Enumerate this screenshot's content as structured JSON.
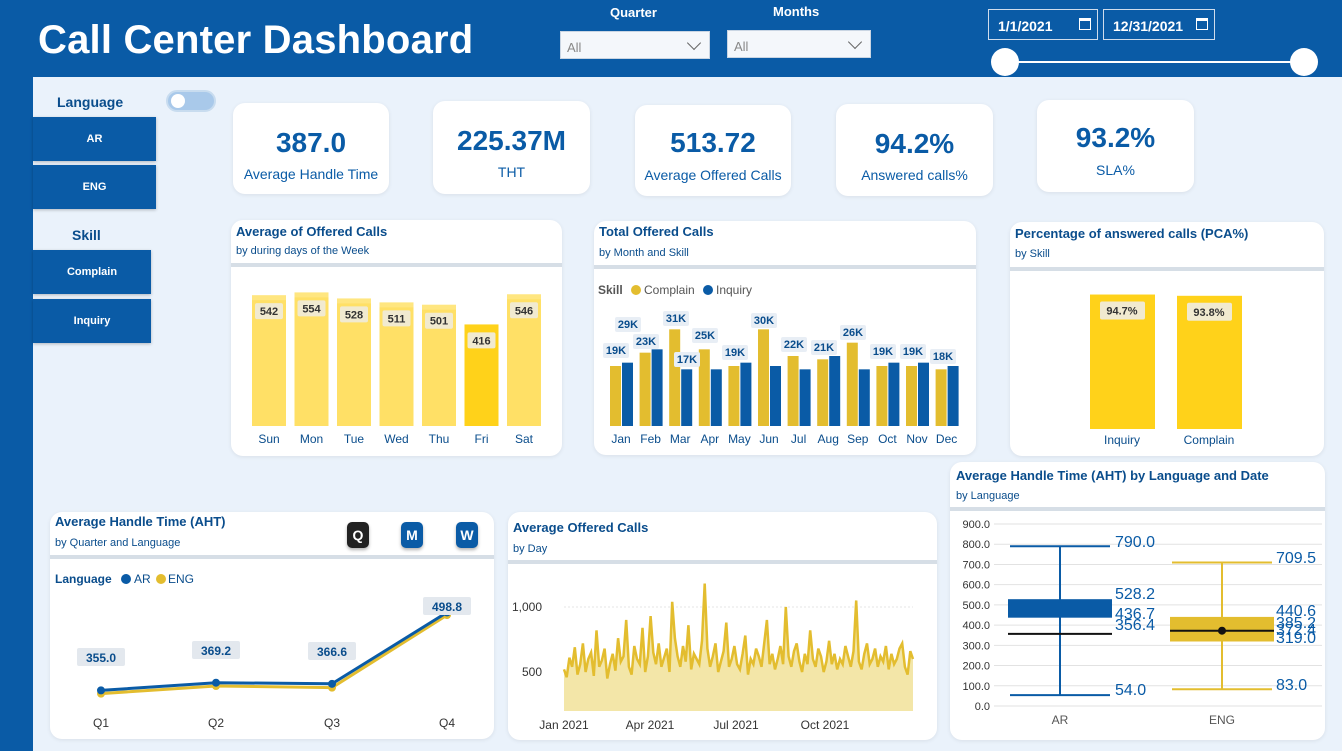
{
  "header": {
    "title": "Call Center Dashboard",
    "quarter_label": "Quarter",
    "quarter_value": "All",
    "months_label": "Months",
    "months_value": "All",
    "start_date": "1/1/2021",
    "end_date": "12/31/2021"
  },
  "sidebar": {
    "language_title": "Language",
    "language_items": [
      "AR",
      "ENG"
    ],
    "skill_title": "Skill",
    "skill_items": [
      "Complain",
      "Inquiry"
    ]
  },
  "kpis": [
    {
      "value": "387.0",
      "label": "Average Handle Time"
    },
    {
      "value": "225.37M",
      "label": "THT"
    },
    {
      "value": "513.72",
      "label": "Average Offered Calls"
    },
    {
      "value": "94.2%",
      "label": "Answered calls%"
    },
    {
      "value": "93.2%",
      "label": "SLA%"
    }
  ],
  "colors": {
    "blue": "#0a5ba6",
    "yellow": "#e3bd2f",
    "light_yellow": "#ffe066",
    "bright_yellow": "#ffd21a"
  },
  "charts": {
    "weekday": {
      "title": "Average of Offered Calls",
      "subtitle": "by during days of the Week"
    },
    "monthly": {
      "title": "Total Offered Calls",
      "subtitle": "by Month and Skill",
      "legend_title": "Skill"
    },
    "pca": {
      "title": "Percentage of answered calls (PCA%)",
      "subtitle": "by Skill"
    },
    "aht_line": {
      "title": "Average Handle Time (AHT)",
      "subtitle": "by Quarter and Language",
      "legend_title": "Language",
      "buttons": [
        "Q",
        "M",
        "W"
      ]
    },
    "daily": {
      "title": "Average Offered Calls",
      "subtitle": "by Day"
    },
    "boxplot": {
      "title": "Average Handle Time (AHT) by Language and Date",
      "subtitle": "by Language"
    }
  },
  "chart_data": [
    {
      "id": "weekday",
      "type": "bar",
      "categories": [
        "Sun",
        "Mon",
        "Tue",
        "Wed",
        "Thu",
        "Fri",
        "Sat"
      ],
      "values": [
        542,
        554,
        528,
        511,
        501,
        416,
        546
      ],
      "highlight": "Fri"
    },
    {
      "id": "monthly",
      "type": "bar",
      "categories": [
        "Jan",
        "Feb",
        "Mar",
        "Apr",
        "May",
        "Jun",
        "Jul",
        "Aug",
        "Sep",
        "Oct",
        "Nov",
        "Dec"
      ],
      "series": [
        {
          "name": "Complain",
          "values": [
            18,
            22,
            29,
            23,
            18,
            29,
            21,
            20,
            25,
            18,
            18,
            17
          ]
        },
        {
          "name": "Inquiry",
          "values": [
            19,
            23,
            17,
            17,
            19,
            18,
            17,
            21,
            17,
            19,
            19,
            18
          ]
        }
      ],
      "data_labels": [
        "19K",
        "29K",
        "23K",
        "31K",
        "17K",
        "25K",
        "19K",
        "30K",
        "22K",
        "21K",
        "26K",
        "19K",
        "19K",
        "18K"
      ],
      "ylim": [
        0,
        33
      ]
    },
    {
      "id": "pca",
      "type": "bar",
      "categories": [
        "Inquiry",
        "Complain"
      ],
      "values": [
        94.7,
        93.8
      ],
      "data_labels": [
        "94.7%",
        "93.8%"
      ]
    },
    {
      "id": "aht_line",
      "type": "line",
      "categories": [
        "Q1",
        "Q2",
        "Q3",
        "Q4"
      ],
      "series": [
        {
          "name": "AR",
          "values": [
            358,
            372,
            370,
            501
          ]
        },
        {
          "name": "ENG",
          "values": [
            352,
            366,
            363,
            496
          ]
        }
      ],
      "data_labels": [
        "355.0",
        "369.2",
        "366.6",
        "498.8"
      ]
    },
    {
      "id": "daily",
      "type": "area",
      "x_ticks": [
        "Jan 2021",
        "Apr 2021",
        "Jul 2021",
        "Oct 2021"
      ],
      "y_ticks": [
        "500",
        "1,000"
      ],
      "ylim": [
        200,
        1200
      ],
      "values": [
        520,
        460,
        610,
        540,
        690,
        480,
        560,
        720,
        500,
        600,
        650,
        470,
        820,
        540,
        590,
        680,
        450,
        560,
        640,
        510,
        760,
        580,
        620,
        900,
        540,
        480,
        700,
        600,
        560,
        840,
        500,
        620,
        930,
        650,
        560,
        720,
        540,
        610,
        680,
        500,
        1040,
        760,
        620,
        540,
        700,
        580,
        860,
        520,
        640,
        600,
        560,
        740,
        1180,
        680,
        540,
        620,
        720,
        500,
        580,
        660,
        880,
        540,
        600,
        700,
        560,
        520,
        640,
        780,
        480,
        600,
        560,
        680,
        620,
        540,
        720,
        900,
        560,
        640,
        520,
        600,
        700,
        560,
        1000,
        620,
        540,
        660,
        720,
        580,
        500,
        640,
        560,
        820,
        600,
        540,
        680,
        620,
        500,
        580,
        740,
        560,
        640,
        520,
        600,
        560,
        700,
        620,
        540,
        660,
        1050,
        580,
        520,
        640,
        720,
        560,
        600,
        680,
        540,
        620,
        580,
        700,
        520,
        640,
        560,
        600,
        680,
        720,
        540,
        480,
        660,
        600
      ],
      "note_values_are_sampled_approximation": "sampled daily average offered calls"
    },
    {
      "id": "boxplot",
      "type": "box",
      "categories": [
        "AR",
        "ENG"
      ],
      "y_ticks": [
        "900.0",
        "800.0",
        "700.0",
        "600.0",
        "500.0",
        "400.0",
        "300.0",
        "200.0",
        "100.0",
        "0.0"
      ],
      "ylim": [
        0,
        900
      ],
      "boxes": [
        {
          "name": "AR",
          "max": 790.0,
          "q3": 528.2,
          "q1": 436.7,
          "median": 356.4,
          "min": 54.0,
          "labels": [
            "790.0",
            "528.2",
            "436.7",
            "356.4",
            "54.0"
          ]
        },
        {
          "name": "ENG",
          "max": 709.5,
          "q3": 440.6,
          "q1": 319.0,
          "median": 385.2,
          "mean": 372.4,
          "min": 83.0,
          "labels": [
            "709.5",
            "440.6",
            "385.2",
            "372.4",
            "319.0",
            "83.0"
          ]
        }
      ]
    }
  ]
}
